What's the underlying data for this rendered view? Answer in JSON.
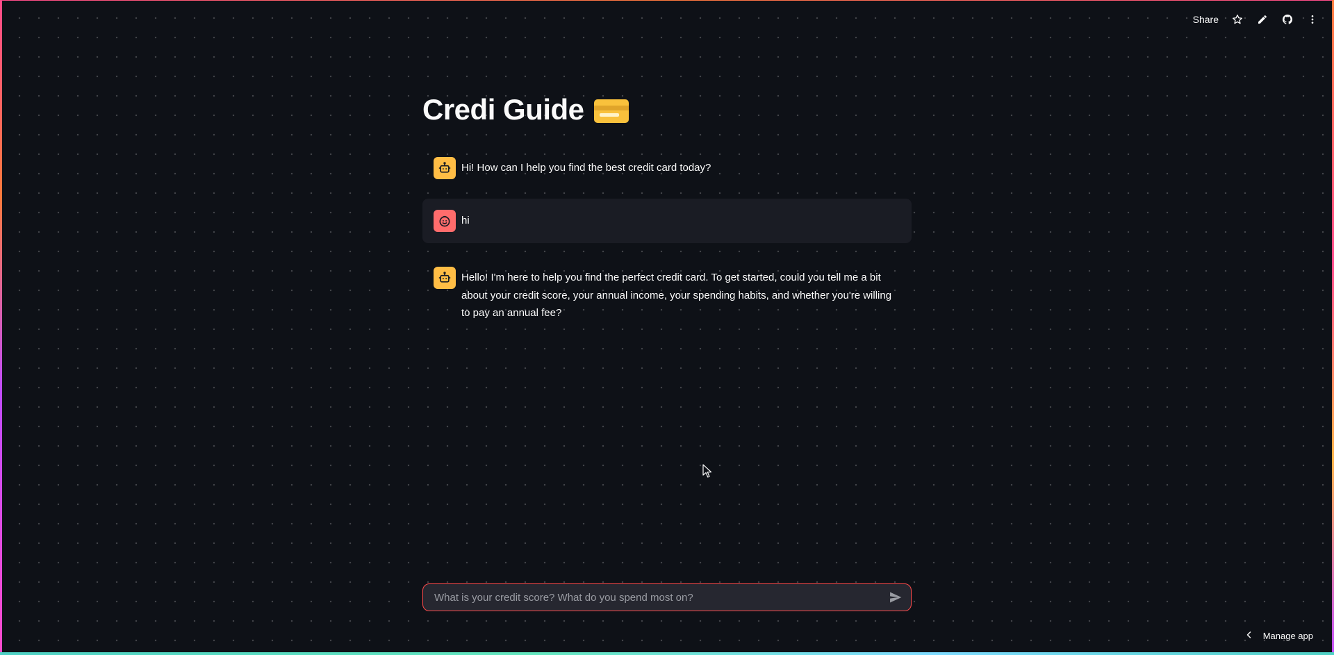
{
  "app": {
    "title": "Credi Guide",
    "title_emoji": "credit-card-emoji"
  },
  "toolbar": {
    "share_label": "Share",
    "icons": [
      "star-icon",
      "pencil-icon",
      "github-icon",
      "more-vertical-icon"
    ]
  },
  "messages": [
    {
      "role": "assistant",
      "avatar": "robot-icon",
      "text": "Hi! How can I help you find the best credit card today?"
    },
    {
      "role": "user",
      "avatar": "smile-face-icon",
      "text": "hi"
    },
    {
      "role": "assistant",
      "avatar": "robot-icon",
      "text": "Hello! I'm here to help you find the perfect credit card. To get started, could you tell me a bit about your credit score, your annual income, your spending habits, and whether you're willing to pay an annual fee?"
    }
  ],
  "chat_input": {
    "placeholder": "What is your credit score? What do you spend most on?",
    "value": ""
  },
  "footer": {
    "manage_app_label": "Manage app"
  },
  "colors": {
    "background": "#0e1117",
    "bot_avatar": "#ffbd45",
    "user_avatar": "#ff6c6c",
    "input_border": "#ff4b4b",
    "user_bubble": "#1a1c24"
  }
}
